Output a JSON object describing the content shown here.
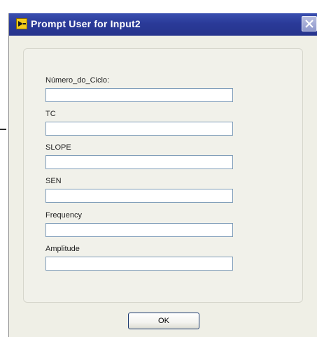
{
  "window": {
    "title": "Prompt User for Input2",
    "title_bar_color": "#2a3a98",
    "background_color": "#efefe6"
  },
  "form": {
    "fields": [
      {
        "label": "Número_do_Ciclo:",
        "value": ""
      },
      {
        "label": "TC",
        "value": ""
      },
      {
        "label": "SLOPE",
        "value": ""
      },
      {
        "label": "SEN",
        "value": ""
      },
      {
        "label": "Frequency",
        "value": ""
      },
      {
        "label": "Amplitude",
        "value": ""
      }
    ]
  },
  "buttons": {
    "ok_label": "OK"
  },
  "icons": {
    "app": "labview-run-icon",
    "close": "close-icon"
  }
}
